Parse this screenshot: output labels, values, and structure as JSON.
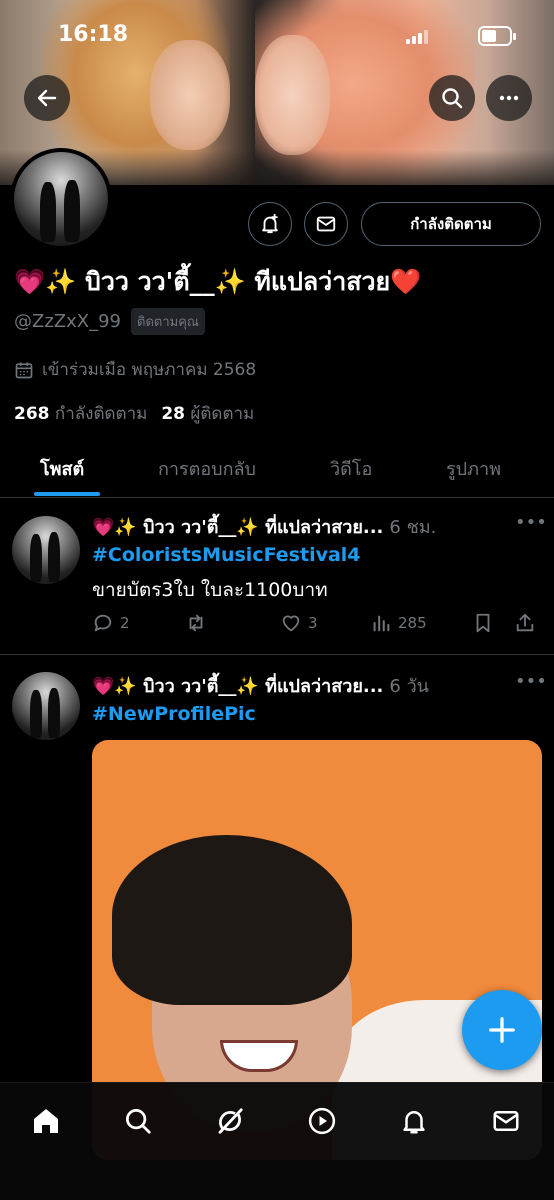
{
  "status_bar": {
    "time": "16:18"
  },
  "profile": {
    "display_name": "💗✨ บิวว วว'ตี้__✨ ทีแปลว่าสวย❤️",
    "handle": "@ZzZxX_99",
    "follows_you": "ติดตามคุณ",
    "joined": "เข้าร่วมเมือ พฤษภาคม 2568",
    "following_count": "268",
    "following_label": "กำลังติดตาม",
    "followers_count": "28",
    "followers_label": "ผู้ติดตาม",
    "follow_button": "กำลังติดตาม"
  },
  "tabs": [
    {
      "label": "โพสต์",
      "active": true
    },
    {
      "label": "การตอบกลับ",
      "active": false
    },
    {
      "label": "วิดีโอ",
      "active": false
    },
    {
      "label": "รูปภาพ",
      "active": false
    }
  ],
  "posts": [
    {
      "name": "💗✨ บิวว วว'ตี้__✨ ที่แปลว่าสวย...",
      "time": "6 ชม.",
      "hashtag": "#ColoristsMusicFestival4",
      "text": "ขายบัตร3ใบ ใบละ1100บาท",
      "replies": "2",
      "reposts": "",
      "likes": "3",
      "views": "285"
    },
    {
      "name": "💗✨ บิวว วว'ตี้__✨ ที่แปลว่าสวย...",
      "time": "6 วัน",
      "hashtag": "#NewProfilePic"
    }
  ],
  "icons": {
    "back": "arrow-left-icon",
    "search": "search-icon",
    "more": "more-horizontal-icon",
    "notifications_add": "bell-plus-icon",
    "message": "envelope-icon",
    "calendar": "calendar-icon",
    "compose": "plus-icon"
  },
  "bottom_nav": [
    "home-icon",
    "search-icon",
    "grok-icon",
    "play-icon",
    "bell-icon",
    "mail-icon"
  ],
  "colors": {
    "accent": "#1d9bf0",
    "background": "#000000",
    "muted": "#71767b"
  }
}
